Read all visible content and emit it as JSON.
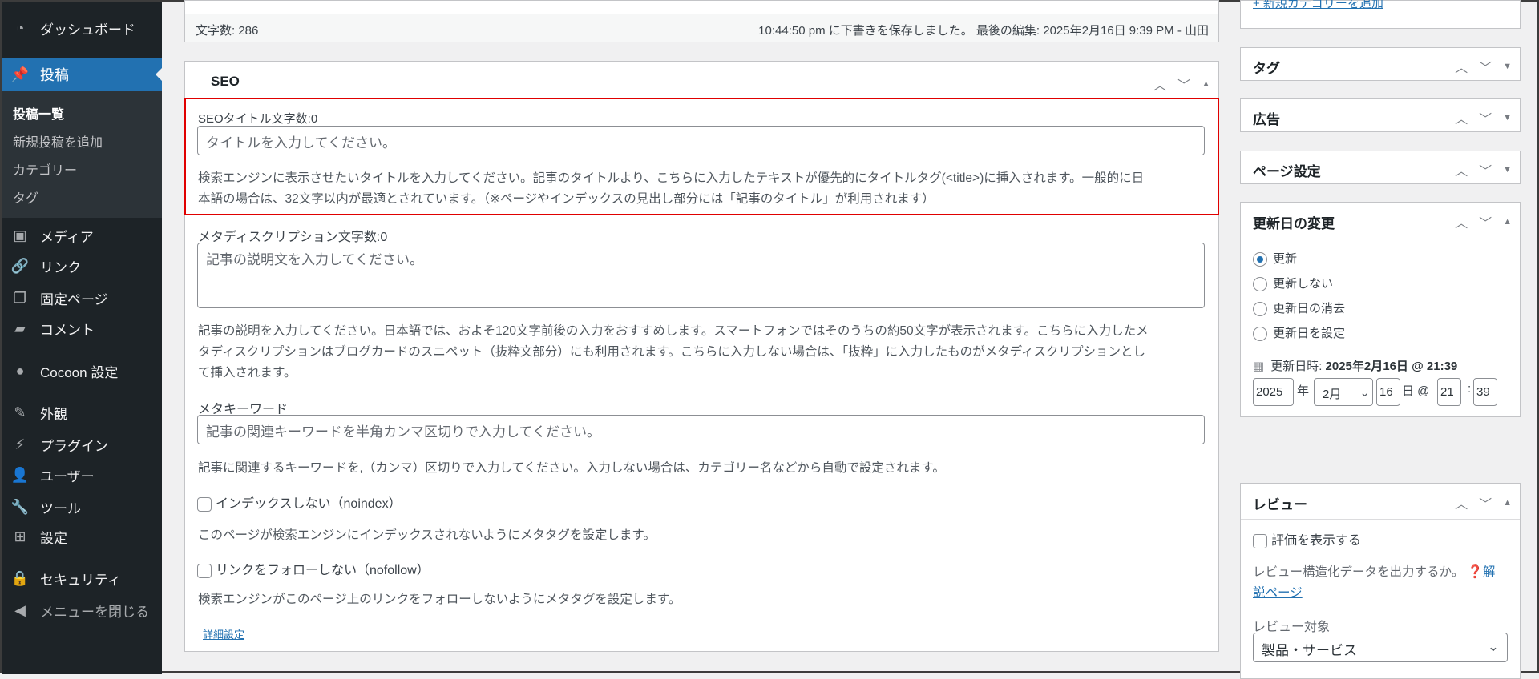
{
  "sidebar": {
    "items": [
      {
        "label": "ダッシュボード",
        "icon": "dashboard-icon",
        "glyph": "◔"
      },
      {
        "label": "投稿",
        "icon": "pin-icon",
        "glyph": "📌"
      },
      {
        "label": "メディア",
        "icon": "media-icon",
        "glyph": "▣"
      },
      {
        "label": "リンク",
        "icon": "link-icon",
        "glyph": "🔗"
      },
      {
        "label": "固定ページ",
        "icon": "pages-icon",
        "glyph": "❐"
      },
      {
        "label": "コメント",
        "icon": "comment-icon",
        "glyph": "▰"
      },
      {
        "label": "Cocoon 設定",
        "icon": "cocoon-icon",
        "glyph": "●"
      },
      {
        "label": "外観",
        "icon": "brush-icon",
        "glyph": "✎"
      },
      {
        "label": "プラグイン",
        "icon": "plugin-icon",
        "glyph": "⚡"
      },
      {
        "label": "ユーザー",
        "icon": "user-icon",
        "glyph": "👤"
      },
      {
        "label": "ツール",
        "icon": "wrench-icon",
        "glyph": "🔧"
      },
      {
        "label": "設定",
        "icon": "settings-icon",
        "glyph": "⊞"
      },
      {
        "label": "セキュリティ",
        "icon": "lock-icon",
        "glyph": "🔒"
      },
      {
        "label": "メニューを閉じる",
        "icon": "collapse-icon",
        "glyph": "◀"
      }
    ],
    "sub": [
      "投稿一覧",
      "新規投稿を追加",
      "カテゴリー",
      "タグ"
    ]
  },
  "status": {
    "word_count": "文字数: 286",
    "saved": "10:44:50 pm に下書きを保存しました。 最後の編集: 2025年2月16日 9:39 PM - 山田"
  },
  "seo": {
    "title": "SEO",
    "title_label": "SEOタイトル文字数:0",
    "title_placeholder": "タイトルを入力してください。",
    "title_help": [
      "検索エンジンに表示させたいタイトルを入力してください。記事のタイトルより、こちらに入力したテキストが優先的にタイトルタグ(<title>)に挿入されます。一般的に日",
      "本語の場合は、32文字以内が最適とされています。（※ページやインデックスの見出し部分には「記事のタイトル」が利用されます）"
    ],
    "desc_label": "メタディスクリプション文字数:0",
    "desc_placeholder": "記事の説明文を入力してください。",
    "desc_help": [
      "記事の説明を入力してください。日本語では、およそ120文字前後の入力をおすすめします。スマートフォンではそのうちの約50文字が表示されます。こちらに入力したメ",
      "タディスクリプションはブログカードのスニペット（抜粋文部分）にも利用されます。こちらに入力しない場合は、「抜粋」に入力したものがメタディスクリプションとし",
      "て挿入されます。"
    ],
    "kw_label": "メタキーワード",
    "kw_placeholder": "記事の関連キーワードを半角カンマ区切りで入力してください。",
    "kw_help": "記事に関連するキーワードを,（カンマ）区切りで入力してください。入力しない場合は、カテゴリー名などから自動で設定されます。",
    "noindex": "インデックスしない（noindex）",
    "noindex_help": "このページが検索エンジンにインデックスされないようにメタタグを設定します。",
    "nofollow": "リンクをフォローしない（nofollow）",
    "nofollow_help": "検索エンジンがこのページ上のリンクをフォローしないようにメタタグを設定します。",
    "advanced": "詳細設定",
    "highlight_color": "#e00000"
  },
  "right": {
    "top_link": "+ 新規カテゴリーを追加",
    "tag": "タグ",
    "ad": "広告",
    "page": "ページ設定",
    "update": {
      "title": "更新日の変更",
      "options": [
        "更新",
        "更新しない",
        "更新日の消去",
        "更新日を設定"
      ],
      "selected": 0,
      "datetime_label": "更新日時:",
      "datetime_value": "2025年2月16日 @ 21:39",
      "year": "2025",
      "year_unit": "年",
      "month": "2月",
      "day": "16",
      "day_unit": "日 @",
      "hour": "21",
      "colon": ":",
      "minute": "39"
    },
    "review": {
      "title": "レビュー",
      "show": "評価を表示する",
      "help": "レビュー構造化データを出力するか。",
      "link1": "解",
      "link2": "説ページ",
      "target_label": "レビュー対象",
      "target": "製品・サービス"
    }
  }
}
